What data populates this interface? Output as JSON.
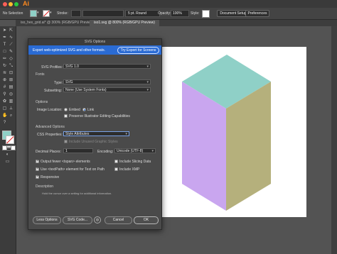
{
  "menubar": {
    "app_glyph": "Ai"
  },
  "controlbar": {
    "selection": "No Selection",
    "stroke_label": "Stroke:",
    "brush": "5 pt. Round",
    "opacity_label": "Opacity:",
    "opacity_value": "100%",
    "style_label": "Style:",
    "document_setup": "Document Setup",
    "preferences": "Preferences"
  },
  "tabs": [
    {
      "label": "iso_hex_grid.ai* @ 300% (RGB/GPU Preview)"
    },
    {
      "label": "iso1.svg @ 800% (RGB/GPU Preview)"
    }
  ],
  "dialog": {
    "title": "SVG Options",
    "banner_text": "Export web-optimized SVG and other formats.",
    "banner_button": "Try Export for Screens",
    "svg_profiles_label": "SVG Profiles:",
    "svg_profiles_value": "SVG 1.0",
    "fonts_header": "Fonts",
    "type_label": "Type:",
    "type_value": "SVG",
    "subsetting_label": "Subsetting:",
    "subsetting_value": "None (Use System Fonts)",
    "options_header": "Options",
    "image_location_label": "Image Location:",
    "embed_label": "Embed",
    "link_label": "Link",
    "preserve_label": "Preserve Illustrator Editing Capabilities",
    "advanced_header": "Advanced Options",
    "css_label": "CSS Properties:",
    "css_value": "Style Attributes",
    "unused_label": "Include Unused Graphic Styles",
    "decimal_label": "Decimal Places:",
    "decimal_value": "1",
    "encoding_label": "Encoding:",
    "encoding_value": "Unicode (UTF-8)",
    "tspan_label": "Output fewer <tspan> elements",
    "textpath_label": "Use <textPath> element for Text on Path",
    "responsive_label": "Responsive",
    "slicing_label": "Include Slicing Data",
    "xmp_label": "Include XMP",
    "description_header": "Description",
    "description_text": "Hold the cursor over a setting for additional information.",
    "less_options": "Less Options",
    "svg_code": "SVG Code...",
    "cancel": "Cancel",
    "ok": "OK"
  },
  "colors": {
    "cube_top": "#8fd0c7",
    "cube_left": "#c9a6ef",
    "cube_right": "#b5b07c",
    "banner": "#2a6bd4",
    "fill_swatch": "#8fd0c7"
  },
  "icons": [
    "selection-tool-icon",
    "direct-selection-icon",
    "pen-icon",
    "type-icon",
    "line-icon",
    "rectangle-icon",
    "brush-icon",
    "eraser-icon",
    "rotate-icon",
    "scale-icon",
    "warp-icon",
    "shape-builder-icon",
    "perspective-icon",
    "mesh-icon",
    "gradient-icon",
    "eyedropper-icon",
    "blend-icon",
    "symbol-icon",
    "graph-icon",
    "artboard-icon",
    "slice-icon",
    "hand-icon",
    "zoom-icon",
    "help-icon"
  ]
}
